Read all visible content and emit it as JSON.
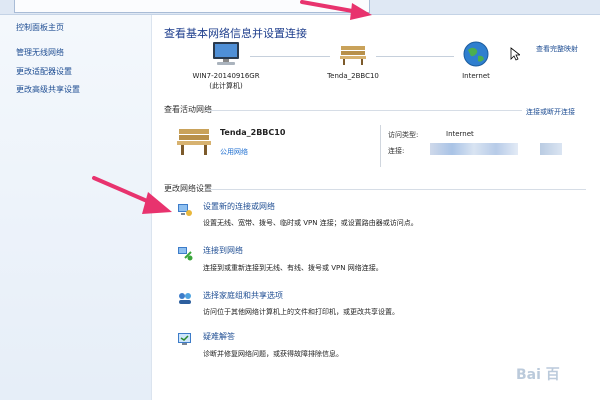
{
  "left_nav": {
    "home": "控制面板主页",
    "items": [
      "管理无线网络",
      "更改适配器设置",
      "更改高级共享设置"
    ]
  },
  "main": {
    "title": "查看基本网络信息并设置连接",
    "see_full_map": "查看完整映射",
    "nodes": [
      {
        "label": "WIN7-20140916GR",
        "sub": "(此计算机)",
        "icon": "computer-icon"
      },
      {
        "label": "Tenda_2BBC10",
        "sub": "",
        "icon": "bench-network-icon"
      },
      {
        "label": "Internet",
        "sub": "",
        "icon": "globe-icon"
      }
    ],
    "active_section": "查看活动网络",
    "connect_disconnect": "连接或断开连接",
    "network": {
      "name": "Tenda_2BBC10",
      "type": "公用网络",
      "access_type_label": "访问类型:",
      "access_type_value": "Internet",
      "connection_label": "连接:"
    },
    "change_section": "更改网络设置",
    "tasks": [
      {
        "title": "设置新的连接或网络",
        "desc": "设置无线、宽带、拨号、临时或 VPN 连接；或设置路由器或访问点。",
        "icon": "new-connection-icon"
      },
      {
        "title": "连接到网络",
        "desc": "连接到或重新连接到无线、有线、拨号或 VPN 网络连接。",
        "icon": "connect-network-icon"
      },
      {
        "title": "选择家庭组和共享选项",
        "desc": "访问位于其他网络计算机上的文件和打印机，或更改共享设置。",
        "icon": "homegroup-icon"
      },
      {
        "title": "疑难解答",
        "desc": "诊断并修复网络问题，或获得故障排除信息。",
        "icon": "troubleshoot-icon"
      }
    ]
  },
  "colors": {
    "link": "#1f4e93",
    "title": "#1d3d8c",
    "arrow": "#e8336e"
  }
}
